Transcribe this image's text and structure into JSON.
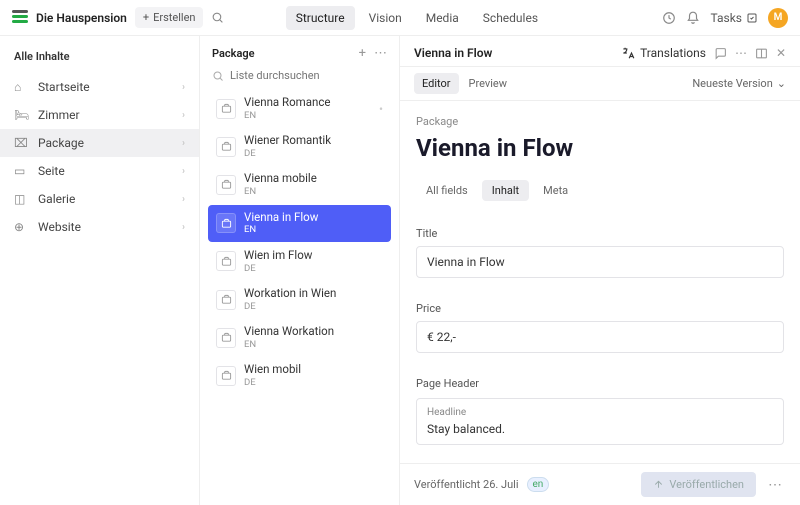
{
  "brand": "Die Hauspension",
  "create_label": "Erstellen",
  "topnav": {
    "structure": "Structure",
    "vision": "Vision",
    "media": "Media",
    "schedules": "Schedules"
  },
  "tasks_label": "Tasks",
  "avatar": "M",
  "sidebar_title": "Alle Inhalte",
  "nav": [
    {
      "icon": "⌂",
      "label": "Startseite",
      "chev": true
    },
    {
      "icon": "🛏",
      "label": "Zimmer",
      "chev": true
    },
    {
      "icon": "⌧",
      "label": "Package",
      "chev": true,
      "active": true
    },
    {
      "icon": "▭",
      "label": "Seite",
      "chev": true
    },
    {
      "icon": "◫",
      "label": "Galerie",
      "chev": true
    },
    {
      "icon": "⊕",
      "label": "Website",
      "chev": true
    }
  ],
  "col2_title": "Package",
  "search_placeholder": "Liste durchsuchen",
  "items": [
    {
      "name": "Vienna Romance",
      "lang": "EN",
      "dot": true
    },
    {
      "name": "Wiener Romantik",
      "lang": "DE"
    },
    {
      "name": "Vienna mobile",
      "lang": "EN"
    },
    {
      "name": "Vienna in Flow",
      "lang": "EN",
      "selected": true
    },
    {
      "name": "Wien im Flow",
      "lang": "DE"
    },
    {
      "name": "Workation in Wien",
      "lang": "DE"
    },
    {
      "name": "Vienna Workation",
      "lang": "EN"
    },
    {
      "name": "Wien mobil",
      "lang": "DE"
    }
  ],
  "doc_breadcrumb": "Vienna in Flow",
  "translations_label": "Translations",
  "view_tabs": {
    "editor": "Editor",
    "preview": "Preview"
  },
  "version_label": "Neueste Version",
  "crumb": "Package",
  "heading": "Vienna in Flow",
  "field_tabs": {
    "all": "All fields",
    "inhalt": "Inhalt",
    "meta": "Meta"
  },
  "fields": {
    "title_label": "Title",
    "title_value": "Vienna in Flow",
    "price_label": "Price",
    "price_value": "€ 22,-",
    "pageheader_label": "Page Header",
    "headline_label": "Headline",
    "headline_value": "Stay balanced."
  },
  "footer": {
    "published": "Veröffentlicht 26. Juli",
    "lang": "en",
    "publish_btn": "Veröffentlichen"
  }
}
